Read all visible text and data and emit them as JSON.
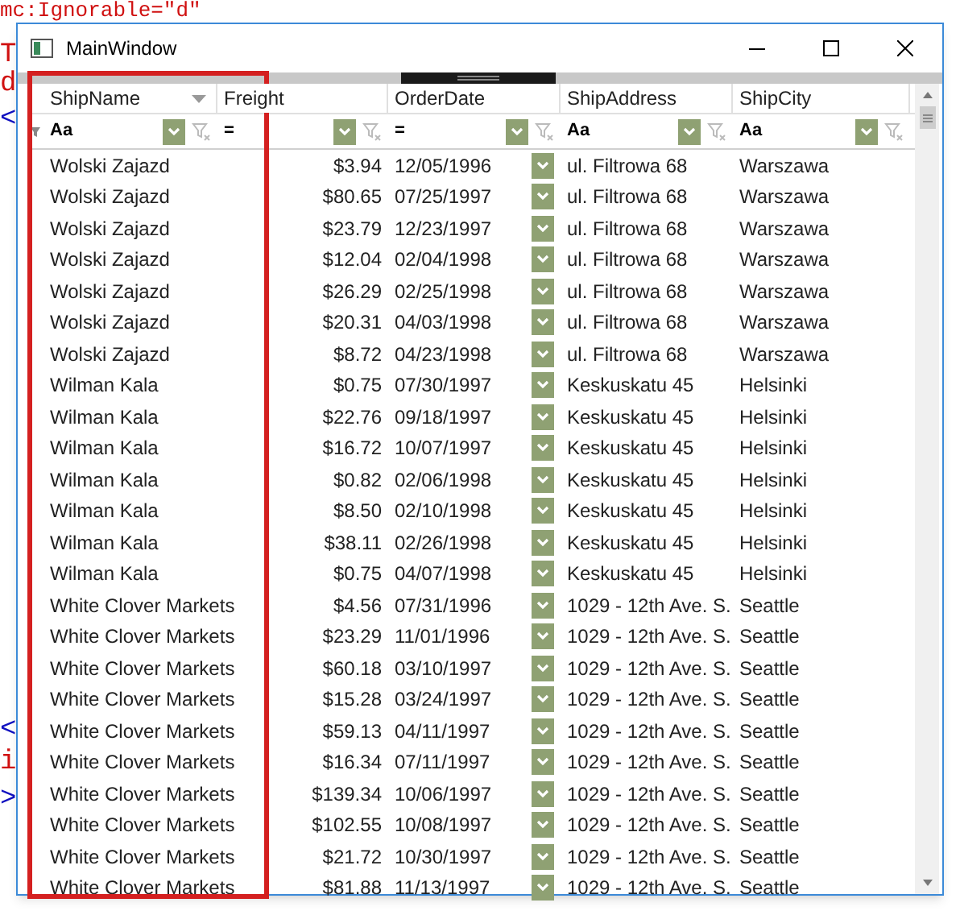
{
  "background_code": [
    {
      "text": "mc:Ignorable=\"d\"",
      "color": "#d01010"
    },
    {
      "text": "T",
      "color": "#d01010"
    },
    {
      "text": "d",
      "color": "#d01010"
    },
    {
      "text": "<",
      "color": "#1010c0"
    },
    {
      "text": "<",
      "color": "#1010c0"
    },
    {
      "text": "i",
      "color": "#d01010"
    },
    {
      "text": ">",
      "color": "#1010c0"
    }
  ],
  "window": {
    "title": "MainWindow"
  },
  "grid": {
    "columns": [
      {
        "label": "ShipName",
        "sort_indicator": true,
        "filter_operator": "Aa",
        "kind": "text"
      },
      {
        "label": "Freight",
        "sort_indicator": false,
        "filter_operator": "=",
        "kind": "currency"
      },
      {
        "label": "OrderDate",
        "sort_indicator": false,
        "filter_operator": "=",
        "kind": "date"
      },
      {
        "label": "ShipAddress",
        "sort_indicator": false,
        "filter_operator": "Aa",
        "kind": "text"
      },
      {
        "label": "ShipCity",
        "sort_indicator": false,
        "filter_operator": "Aa",
        "kind": "text"
      }
    ],
    "rows": [
      [
        "Wolski Zajazd",
        "$3.94",
        "12/05/1996",
        "ul. Filtrowa 68",
        "Warszawa"
      ],
      [
        "Wolski Zajazd",
        "$80.65",
        "07/25/1997",
        "ul. Filtrowa 68",
        "Warszawa"
      ],
      [
        "Wolski Zajazd",
        "$23.79",
        "12/23/1997",
        "ul. Filtrowa 68",
        "Warszawa"
      ],
      [
        "Wolski Zajazd",
        "$12.04",
        "02/04/1998",
        "ul. Filtrowa 68",
        "Warszawa"
      ],
      [
        "Wolski Zajazd",
        "$26.29",
        "02/25/1998",
        "ul. Filtrowa 68",
        "Warszawa"
      ],
      [
        "Wolski Zajazd",
        "$20.31",
        "04/03/1998",
        "ul. Filtrowa 68",
        "Warszawa"
      ],
      [
        "Wolski Zajazd",
        "$8.72",
        "04/23/1998",
        "ul. Filtrowa 68",
        "Warszawa"
      ],
      [
        "Wilman Kala",
        "$0.75",
        "07/30/1997",
        "Keskuskatu 45",
        "Helsinki"
      ],
      [
        "Wilman Kala",
        "$22.76",
        "09/18/1997",
        "Keskuskatu 45",
        "Helsinki"
      ],
      [
        "Wilman Kala",
        "$16.72",
        "10/07/1997",
        "Keskuskatu 45",
        "Helsinki"
      ],
      [
        "Wilman Kala",
        "$0.82",
        "02/06/1998",
        "Keskuskatu 45",
        "Helsinki"
      ],
      [
        "Wilman Kala",
        "$8.50",
        "02/10/1998",
        "Keskuskatu 45",
        "Helsinki"
      ],
      [
        "Wilman Kala",
        "$38.11",
        "02/26/1998",
        "Keskuskatu 45",
        "Helsinki"
      ],
      [
        "Wilman Kala",
        "$0.75",
        "04/07/1998",
        "Keskuskatu 45",
        "Helsinki"
      ],
      [
        "White Clover Markets",
        "$4.56",
        "07/31/1996",
        "1029 - 12th Ave. S.",
        "Seattle"
      ],
      [
        "White Clover Markets",
        "$23.29",
        "11/01/1996",
        "1029 - 12th Ave. S.",
        "Seattle"
      ],
      [
        "White Clover Markets",
        "$60.18",
        "03/10/1997",
        "1029 - 12th Ave. S.",
        "Seattle"
      ],
      [
        "White Clover Markets",
        "$15.28",
        "03/24/1997",
        "1029 - 12th Ave. S.",
        "Seattle"
      ],
      [
        "White Clover Markets",
        "$59.13",
        "04/11/1997",
        "1029 - 12th Ave. S.",
        "Seattle"
      ],
      [
        "White Clover Markets",
        "$16.34",
        "07/11/1997",
        "1029 - 12th Ave. S.",
        "Seattle"
      ],
      [
        "White Clover Markets",
        "$139.34",
        "10/06/1997",
        "1029 - 12th Ave. S.",
        "Seattle"
      ],
      [
        "White Clover Markets",
        "$102.55",
        "10/08/1997",
        "1029 - 12th Ave. S.",
        "Seattle"
      ],
      [
        "White Clover Markets",
        "$21.72",
        "10/30/1997",
        "1029 - 12th Ave. S.",
        "Seattle"
      ],
      [
        "White Clover Markets",
        "$81.88",
        "11/13/1997",
        "1029 - 12th Ave. S.",
        "Seattle"
      ]
    ]
  }
}
